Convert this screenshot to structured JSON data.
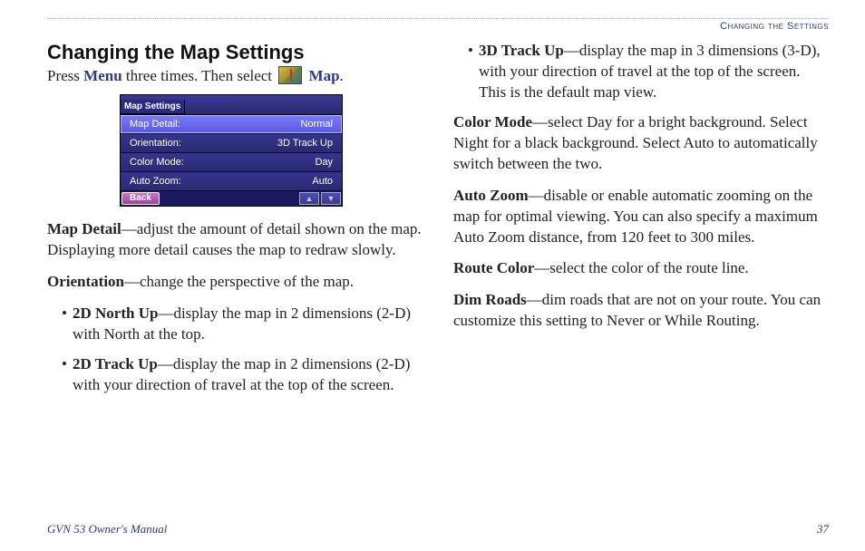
{
  "header": {
    "tag": "Changing the Settings"
  },
  "title": "Changing the Map Settings",
  "intro": {
    "prefix": "Press ",
    "menu": "Menu",
    "mid": " three times. Then select ",
    "map": "Map",
    "suffix": "."
  },
  "screenshot": {
    "title": "Map Settings",
    "rows": [
      {
        "label": "Map Detail:",
        "value": "Normal",
        "selected": true
      },
      {
        "label": "Orientation:",
        "value": "3D Track Up",
        "selected": false
      },
      {
        "label": "Color Mode:",
        "value": "Day",
        "selected": false
      },
      {
        "label": "Auto Zoom:",
        "value": "Auto",
        "selected": false
      }
    ],
    "back": "Back"
  },
  "left": {
    "mapDetail": {
      "term": "Map Detail",
      "text": "—adjust the amount of detail shown on the map. Displaying more detail causes the map to redraw slowly."
    },
    "orientation": {
      "term": "Orientation",
      "text": "—change the perspective of the map."
    },
    "orient1": {
      "term": "2D North Up",
      "text": "—display the map in 2 dimensions (2-D) with North at the top."
    },
    "orient2": {
      "term": "2D Track Up",
      "text": "—display the map in 2 dimensions (2-D) with your direction of travel at the top of the screen."
    }
  },
  "right": {
    "orient3": {
      "term": "3D Track Up",
      "text": "—display the map in 3 dimensions (3-D), with your direction of travel at the top of the screen. This is the default map view."
    },
    "colorMode": {
      "term": "Color Mode",
      "text": "—select Day for a bright background. Select Night for a black background. Select Auto to automatically switch between the two."
    },
    "autoZoom": {
      "term": "Auto Zoom",
      "text": "—disable or enable automatic zooming on the map for optimal viewing. You can also specify a maximum Auto Zoom distance, from 120 feet to 300 miles."
    },
    "routeColor": {
      "term": "Route Color",
      "text": "—select the color of the route line."
    },
    "dimRoads": {
      "term": "Dim Roads",
      "text": "—dim roads that are not on your route. You can customize this setting to Never or While Routing."
    }
  },
  "footer": {
    "left": "GVN 53 Owner's Manual",
    "right": "37"
  }
}
